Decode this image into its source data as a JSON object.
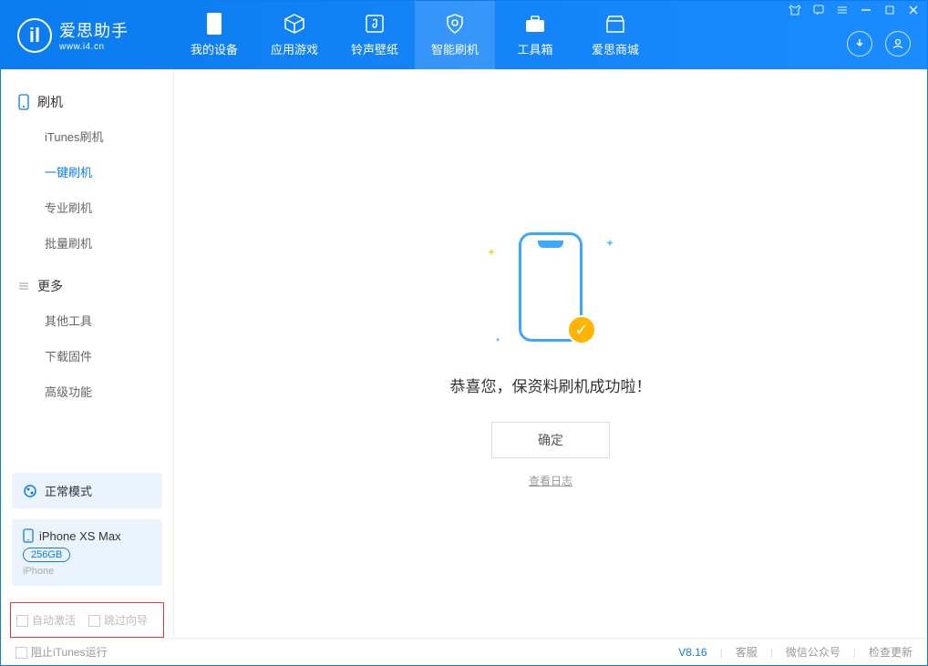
{
  "app": {
    "name_cn": "爱思助手",
    "name_en": "www.i4.cn"
  },
  "nav": [
    {
      "label": "我的设备",
      "icon": "device"
    },
    {
      "label": "应用游戏",
      "icon": "cube"
    },
    {
      "label": "铃声壁纸",
      "icon": "music"
    },
    {
      "label": "智能刷机",
      "icon": "shield",
      "active": true
    },
    {
      "label": "工具箱",
      "icon": "toolbox"
    },
    {
      "label": "爱思商城",
      "icon": "store"
    }
  ],
  "sidebar": {
    "group1_title": "刷机",
    "group1_items": [
      "iTunes刷机",
      "一键刷机",
      "专业刷机",
      "批量刷机"
    ],
    "group1_active_index": 1,
    "group2_title": "更多",
    "group2_items": [
      "其他工具",
      "下载固件",
      "高级功能"
    ]
  },
  "mode": {
    "label": "正常模式"
  },
  "device": {
    "name": "iPhone XS Max",
    "storage": "256GB",
    "type": "iPhone"
  },
  "options": {
    "auto_activate": "自动激活",
    "skip_guide": "跳过向导"
  },
  "main": {
    "success_text": "恭喜您，保资料刷机成功啦！",
    "ok_button": "确定",
    "view_log": "查看日志"
  },
  "footer": {
    "block_itunes": "阻止iTunes运行",
    "version": "V8.16",
    "links": [
      "客服",
      "微信公众号",
      "检查更新"
    ]
  }
}
